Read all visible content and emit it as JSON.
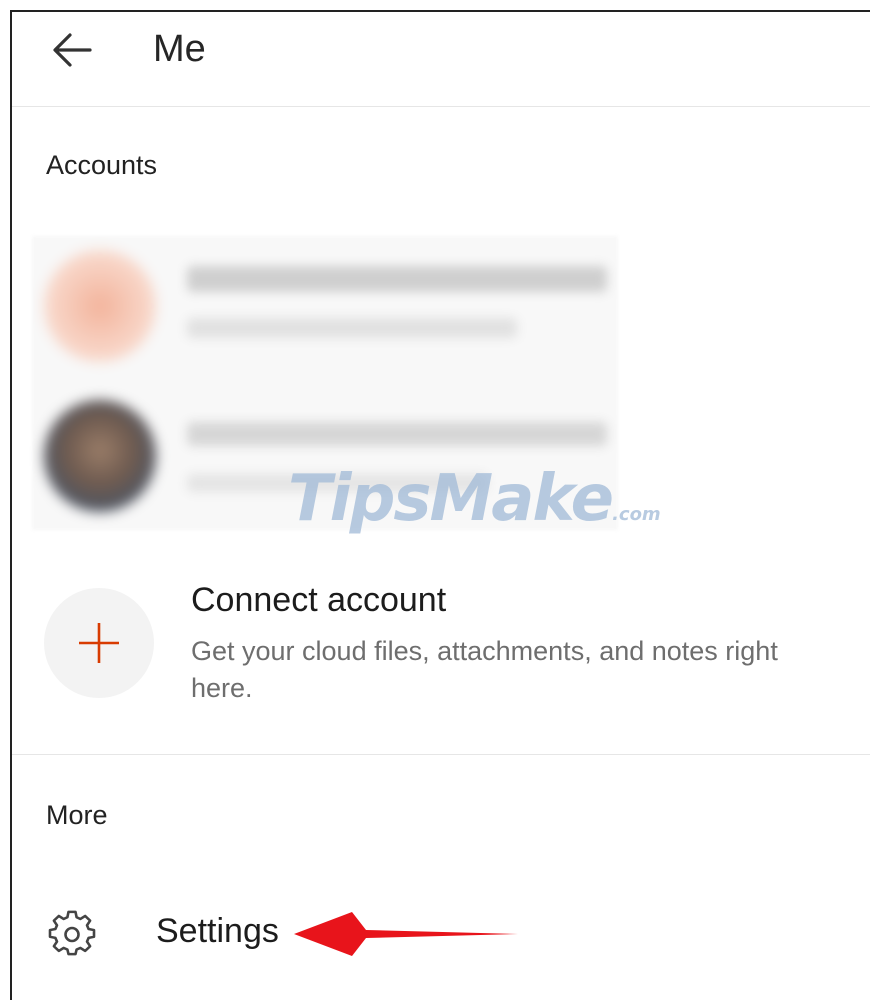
{
  "header": {
    "title": "Me",
    "back_icon": "arrow-left-icon"
  },
  "accounts": {
    "label": "Accounts"
  },
  "connect": {
    "title": "Connect account",
    "subtitle": "Get your cloud files, attachments, and notes right here.",
    "icon": "plus-icon",
    "accent": "#d83b01"
  },
  "watermark": {
    "brand": "TipsMake",
    "suffix": ".com"
  },
  "more": {
    "label": "More",
    "settings": {
      "label": "Settings",
      "icon": "gear-icon"
    }
  },
  "annotation": {
    "icon": "red-arrow-icon",
    "color": "#e8141b"
  }
}
